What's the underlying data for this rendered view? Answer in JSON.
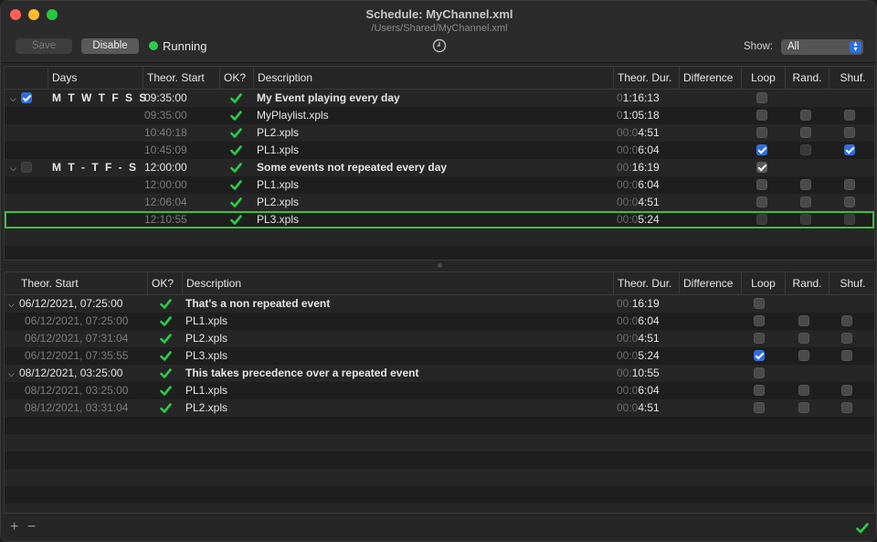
{
  "window": {
    "title": "Schedule: MyChannel.xml",
    "subtitle": "/Users/Shared/MyChannel.xml"
  },
  "toolbar": {
    "save_label": "Save",
    "disable_label": "Disable",
    "status_label": "Running",
    "show_label": "Show:",
    "show_value": "All"
  },
  "colors": {
    "accent": "#2f6fdd",
    "ok_green": "#2bcc4a",
    "selection_outline": "#3fbf3f"
  },
  "top_table": {
    "headers": {
      "days": "Days",
      "theor_start": "Theor. Start",
      "ok": "OK?",
      "description": "Description",
      "theor_dur": "Theor. Dur.",
      "difference": "Difference",
      "loop": "Loop",
      "rand": "Rand.",
      "shuf": "Shuf."
    },
    "rows": [
      {
        "kind": "group",
        "enabled": true,
        "days": "M T W T F S S",
        "start": "09:35:00",
        "desc": "My Event playing every day",
        "dur_pre": "0",
        "dur_main": "1:16:13",
        "loop": false,
        "rand": null,
        "shuf": null
      },
      {
        "kind": "child",
        "start": "09:35:00",
        "desc": "MyPlaylist.xpls",
        "dur_pre": "0",
        "dur_main": "1:05:18",
        "loop": false,
        "rand": false,
        "shuf": false
      },
      {
        "kind": "child",
        "start": "10:40:18",
        "desc": "PL2.xpls",
        "dur_pre": "00:0",
        "dur_main": "4:51",
        "loop": false,
        "rand": false,
        "shuf": false
      },
      {
        "kind": "child",
        "start": "10:45:09",
        "desc": "PL1.xpls",
        "dur_pre": "00:0",
        "dur_main": "6:04",
        "loop": true,
        "rand": false,
        "shuf": true,
        "rand_disabled": true
      },
      {
        "kind": "group",
        "enabled": false,
        "days": "M T - T F - S",
        "start": "12:00:00",
        "desc": "Some events not repeated every day",
        "dur_pre": "00:",
        "dur_main": "16:19",
        "loop": true,
        "loop_disabled": true,
        "rand": null,
        "shuf": null
      },
      {
        "kind": "child",
        "start": "12:00:00",
        "desc": "PL1.xpls",
        "dur_pre": "00:0",
        "dur_main": "6:04",
        "loop": false,
        "rand": false,
        "shuf": false
      },
      {
        "kind": "child",
        "start": "12:06:04",
        "desc": "PL2.xpls",
        "dur_pre": "00:0",
        "dur_main": "4:51",
        "loop": false,
        "rand": false,
        "shuf": false
      },
      {
        "kind": "child",
        "selected": true,
        "start": "12:10:55",
        "desc": "PL3.xpls",
        "dur_pre": "00:0",
        "dur_main": "5:24",
        "loop": false,
        "rand": false,
        "shuf": false,
        "all_disabled": true
      }
    ]
  },
  "bottom_table": {
    "headers": {
      "theor_start": "Theor. Start",
      "ok": "OK?",
      "description": "Description",
      "theor_dur": "Theor. Dur.",
      "difference": "Difference",
      "loop": "Loop",
      "rand": "Rand.",
      "shuf": "Shuf."
    },
    "rows": [
      {
        "kind": "group",
        "start": "06/12/2021, 07:25:00",
        "desc": "That's a non repeated event",
        "dur_pre": "00:",
        "dur_main": "16:19",
        "loop": false,
        "rand": null,
        "shuf": null
      },
      {
        "kind": "child",
        "start": "06/12/2021, 07:25:00",
        "desc": "PL1.xpls",
        "dur_pre": "00:0",
        "dur_main": "6:04",
        "loop": false,
        "rand": false,
        "shuf": false
      },
      {
        "kind": "child",
        "start": "06/12/2021, 07:31:04",
        "desc": "PL2.xpls",
        "dur_pre": "00:0",
        "dur_main": "4:51",
        "loop": false,
        "rand": false,
        "shuf": false
      },
      {
        "kind": "child",
        "start": "06/12/2021, 07:35:55",
        "desc": "PL3.xpls",
        "dur_pre": "00:0",
        "dur_main": "5:24",
        "loop": true,
        "rand": false,
        "shuf": false
      },
      {
        "kind": "group",
        "start": "08/12/2021, 03:25:00",
        "desc": "This takes precedence over a repeated event",
        "dur_pre": "00:",
        "dur_main": "10:55",
        "loop": false,
        "rand": null,
        "shuf": null
      },
      {
        "kind": "child",
        "start": "08/12/2021, 03:25:00",
        "desc": "PL1.xpls",
        "dur_pre": "00:0",
        "dur_main": "6:04",
        "loop": false,
        "rand": false,
        "shuf": false
      },
      {
        "kind": "child",
        "start": "08/12/2021, 03:31:04",
        "desc": "PL2.xpls",
        "dur_pre": "00:0",
        "dur_main": "4:51",
        "loop": false,
        "rand": false,
        "shuf": false
      }
    ]
  },
  "footer": {
    "add_label": "+",
    "remove_label": "−"
  }
}
